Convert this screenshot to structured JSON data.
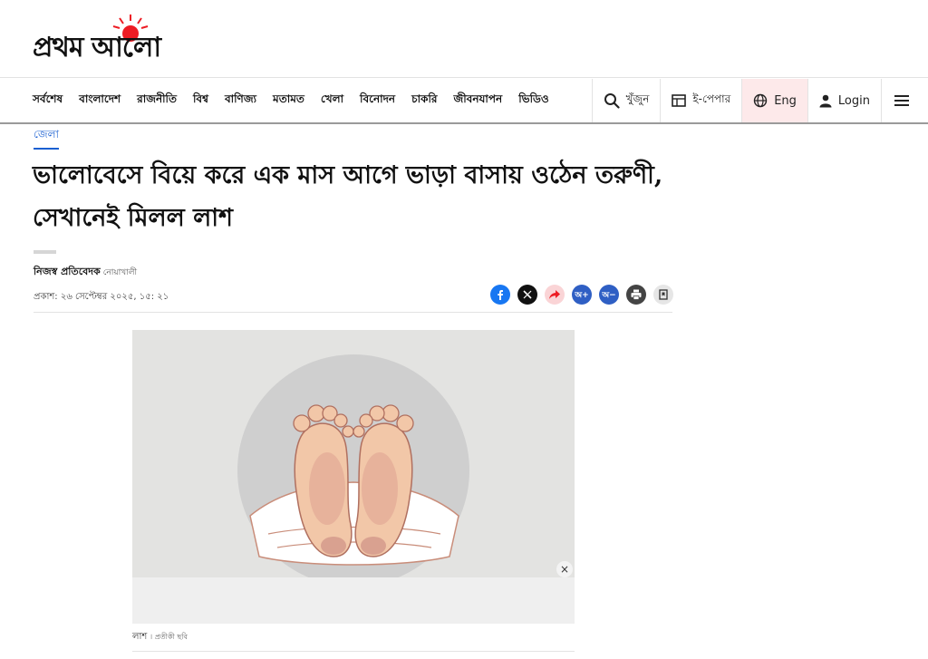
{
  "brand": {
    "logo_text": "প্রথম আলো",
    "accent": "#ed1c24"
  },
  "nav": {
    "links": [
      "সর্বশেষ",
      "বাংলাদেশ",
      "রাজনীতি",
      "বিশ্ব",
      "বাণিজ্য",
      "মতামত",
      "খেলা",
      "বিনোদন",
      "চাকরি",
      "জীবনযাপন",
      "ভিডিও"
    ],
    "search_label": "খুঁজুন",
    "epaper_label": "ই-পেপার",
    "language_label": "Eng",
    "login_label": "Login"
  },
  "article": {
    "section": "জেলা",
    "headline": "ভালোবেসে বিয়ে করে এক মাস আগে ভাড়া বাসায় ওঠেন তরুণী, সেখানেই মিলল লাশ",
    "author": "নিজস্ব প্রতিবেদক",
    "location": "নোয়াখালী",
    "published": "প্রকাশ: ২৬ সেপ্টেম্বর ২০২৫, ১৫: ২১",
    "share_icons": [
      "facebook-icon",
      "x-icon",
      "share-icon",
      "font-increase-icon",
      "font-decrease-icon",
      "print-icon",
      "bookmark-icon"
    ],
    "font_increase_label": "অ+",
    "font_decrease_label": "অ−"
  },
  "image": {
    "caption": "লাশ",
    "credit": "প্রতীকী ছবি",
    "close_symbol": "×"
  }
}
